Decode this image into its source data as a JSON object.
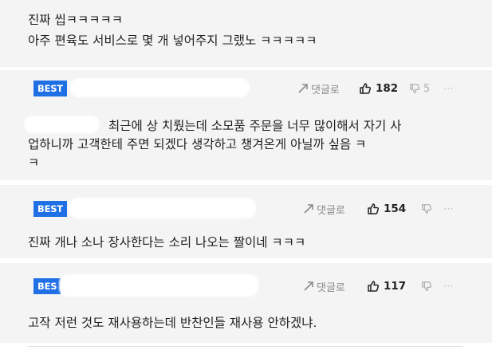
{
  "colors": {
    "best_badge_bg": "#1f6fe5",
    "meta_gray": "#8a8a8a",
    "strip_bg": "#f4f4f4"
  },
  "icons": {
    "reply": "reply-arrow-icon",
    "like": "thumbs-up-icon",
    "dislike": "thumbs-down-icon",
    "more": "more-dots-icon"
  },
  "top_comment": {
    "line1": "진짜 씹ㅋㅋㅋㅋㅋ",
    "line2": "아주 편육도 서비스로 몇 개 넣어주지 그랬노 ㅋㅋㅋㅋㅋ"
  },
  "comments": [
    {
      "badge": "BEST",
      "reply_label": "댓글로",
      "likes": "182",
      "dislikes": "5",
      "more": "···",
      "text_line1": "최근에 상 치뤘는데 소모품 주문을 너무 많이해서 자기 사",
      "text_line2": "업하니까 고객한테 주면 되겠다 생각하고 챙겨온게 아닐까 싶음 ㅋ",
      "text_line3": "ㅋ"
    },
    {
      "badge": "BEST",
      "reply_label": "댓글로",
      "likes": "154",
      "more": "···",
      "text": "진짜 개나 소나 장사한다는 소리 나오는 짤이네 ㅋㅋㅋ"
    },
    {
      "badge": "BES",
      "reply_label": "댓글로",
      "likes": "117",
      "more": "···",
      "text": "고작 저런 것도 재사용하는데 반찬인들 재사용 안하겠냐."
    }
  ]
}
